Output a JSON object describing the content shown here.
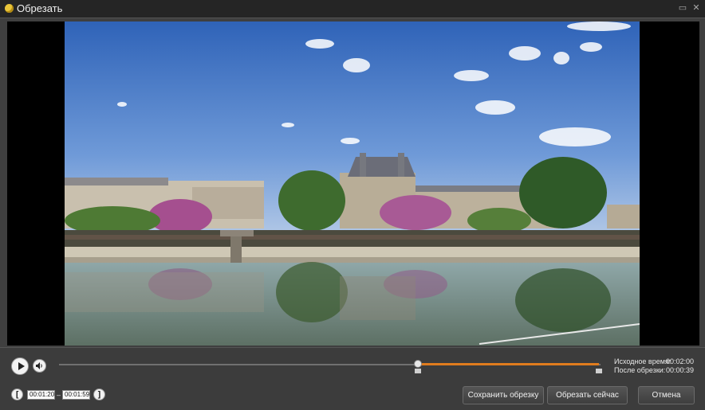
{
  "window": {
    "title": "Обрезать",
    "minimize_glyph": "▭",
    "close_glyph": "✕"
  },
  "player": {
    "play_icon": "play-icon",
    "volume_icon": "speaker-icon",
    "progress_fraction": 0.65,
    "trim_start_fraction": 0.66,
    "trim_end_fraction": 1.0,
    "accent_color": "#e07c1e"
  },
  "info": {
    "original_label": "Исходное время:",
    "original_value": "00:02:00",
    "after_label": "После обрезки:",
    "after_value": "00:00:39"
  },
  "trim": {
    "start_bracket": "[",
    "start_time": "00:01:20",
    "separator": "–",
    "end_time": "00:01:59",
    "end_bracket": "]"
  },
  "buttons": {
    "save_trim": "Сохранить обрезку",
    "trim_now": "Обрезать сейчас",
    "cancel": "Отмена"
  }
}
